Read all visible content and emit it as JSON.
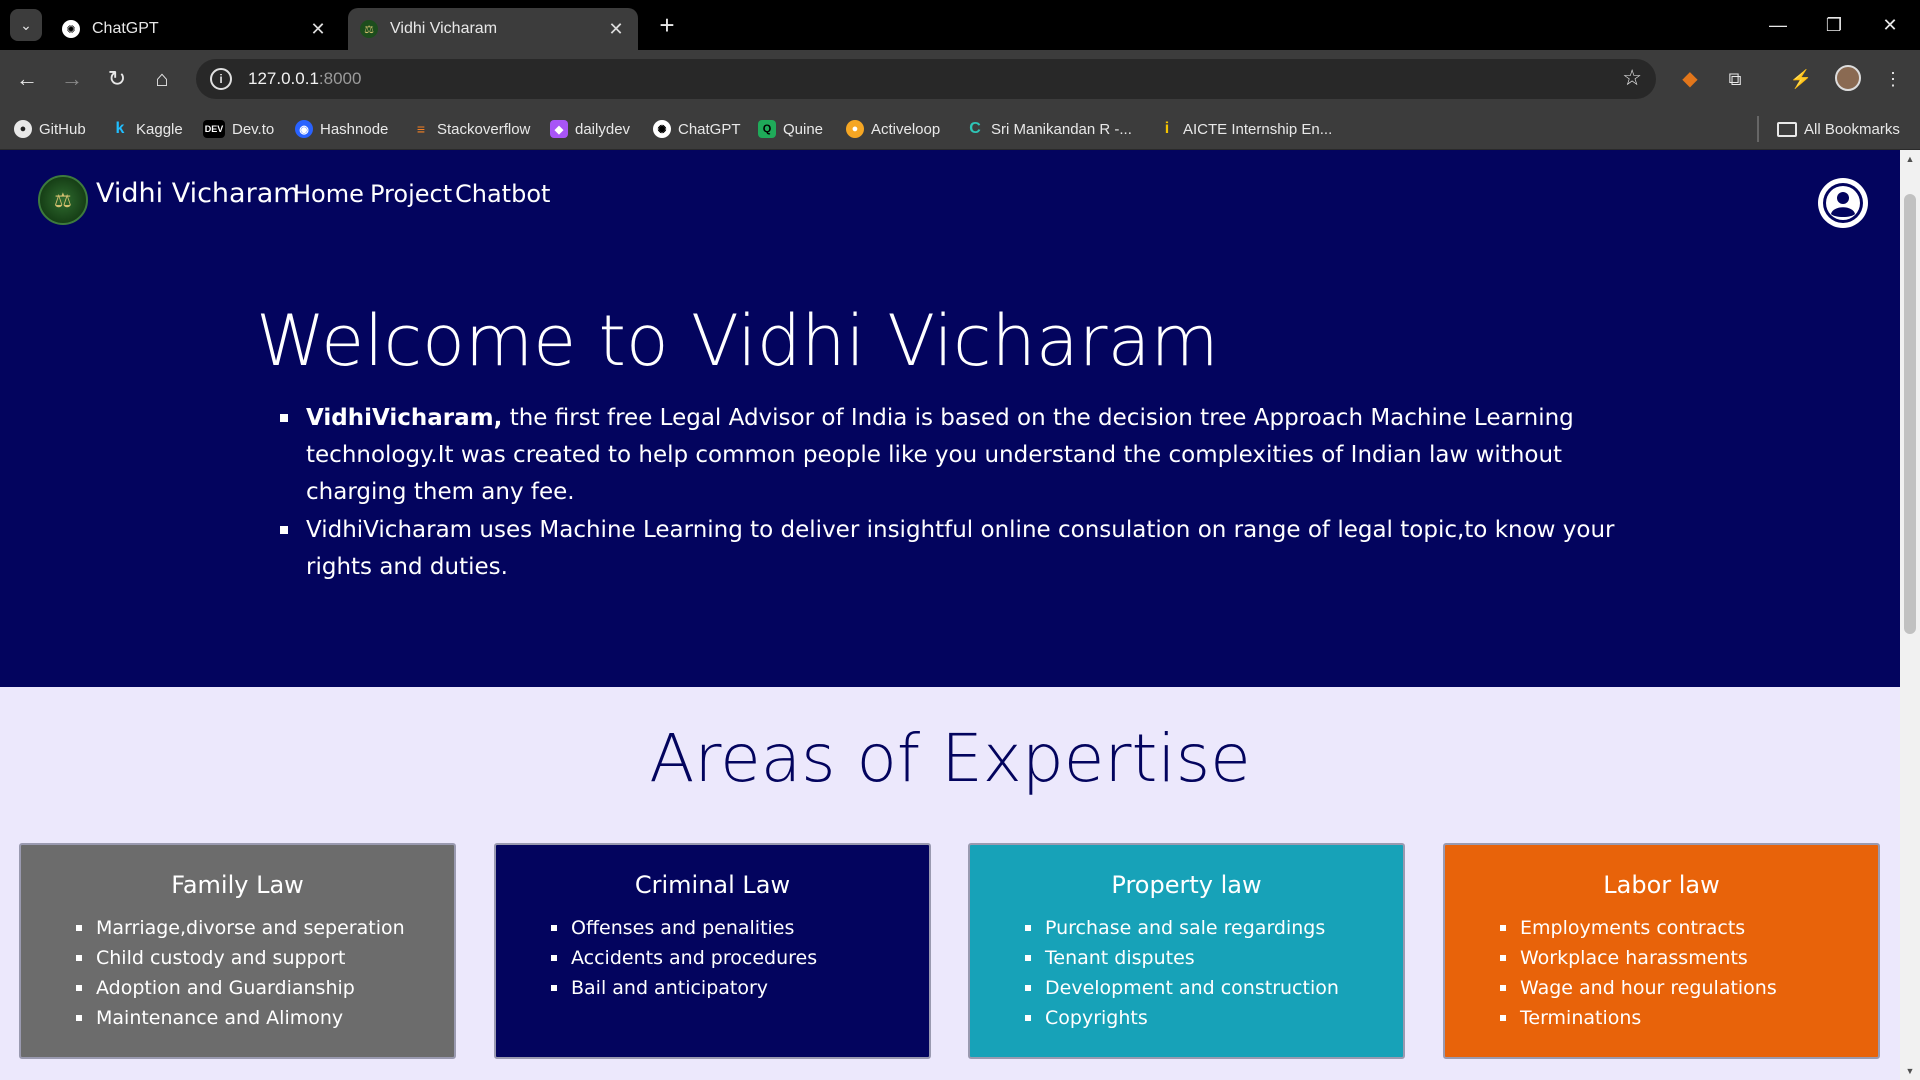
{
  "browser": {
    "tabs": [
      {
        "title": "ChatGPT",
        "active": false
      },
      {
        "title": "Vidhi Vicharam",
        "active": true
      }
    ],
    "address": {
      "host": "127.0.0.1",
      "port": ":8000"
    },
    "bookmarks": [
      {
        "label": "GitHub",
        "icon": "github-icon"
      },
      {
        "label": "Kaggle",
        "icon": "kaggle-icon"
      },
      {
        "label": "Dev.to",
        "icon": "devto-icon"
      },
      {
        "label": "Hashnode",
        "icon": "hashnode-icon"
      },
      {
        "label": "Stackoverflow",
        "icon": "stackoverflow-icon"
      },
      {
        "label": "dailydev",
        "icon": "dailydev-icon"
      },
      {
        "label": "ChatGPT",
        "icon": "chatgpt-icon"
      },
      {
        "label": "Quine",
        "icon": "quine-icon"
      },
      {
        "label": "Activeloop",
        "icon": "activeloop-icon"
      },
      {
        "label": "Sri Manikandan R -...",
        "icon": "c-icon"
      },
      {
        "label": "AICTE Internship En...",
        "icon": "aicte-icon"
      }
    ],
    "all_bookmarks": "All Bookmarks"
  },
  "nav": {
    "brand": "Vidhi Vicharam",
    "links": [
      "Home",
      "Project",
      "Chatbot"
    ]
  },
  "hero": {
    "title": "Welcome to Vidhi Vicharam",
    "point1_strong": "VidhiVicharam,",
    "point1_rest": " the first free Legal Advisor of India is based on the decision tree Approach Machine Learning technology.It was created to help common people like you understand the complexities of Indian law without charging them any fee.",
    "point2": "VidhiVicharam uses Machine Learning to deliver insightful online consulation on range of legal topic,to know your rights and duties."
  },
  "expertise": {
    "title": "Areas of Expertise",
    "cards": [
      {
        "title": "Family Law",
        "color": "#6c6c6c",
        "items": [
          "Marriage,divorse and seperation",
          "Child custody and support",
          "Adoption and Guardianship",
          "Maintenance and Alimony"
        ]
      },
      {
        "title": "Criminal Law",
        "color": "#03045e",
        "items": [
          "Offenses and penalities",
          "Accidents and procedures",
          "Bail and anticipatory"
        ]
      },
      {
        "title": "Property law",
        "color": "#17a2b8",
        "items": [
          "Purchase and sale regardings",
          "Tenant disputes",
          "Development and construction",
          "Copyrights"
        ]
      },
      {
        "title": "Labor law",
        "color": "#e8630a",
        "items": [
          "Employments contracts",
          "Workplace harassments",
          "Wage and hour regulations",
          "Terminations"
        ]
      }
    ]
  }
}
